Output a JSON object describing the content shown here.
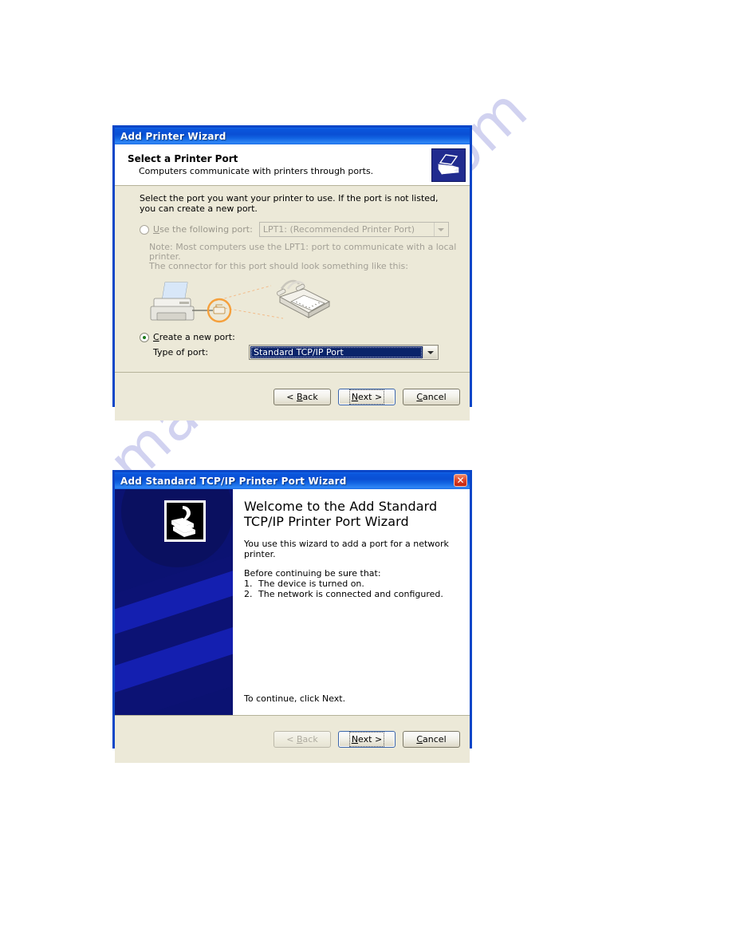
{
  "page": {
    "watermark_text": "manualshive.com"
  },
  "dialog1": {
    "title": "Add Printer Wizard",
    "heading": "Select a Printer Port",
    "subheading": "Computers communicate with printers through ports.",
    "header_icon": "printer-icon",
    "intro": "Select the port you want your printer to use.  If the port is not listed, you can create a new port.",
    "option_existing": {
      "label_prefix": "",
      "label_accel": "U",
      "label_rest": "se the following port:",
      "label_full": "Use the following port:",
      "selected": false,
      "enabled": false,
      "port_value": "LPT1: (Recommended Printer Port)"
    },
    "note_line1": "Note: Most computers use the LPT1: port to communicate with a local printer.",
    "note_line2": "The connector for this port should look something like this:",
    "illustration": {
      "printer_icon": "printer-illustration",
      "connector_icon": "parallel-port-connector-illustration",
      "highlight_icon": "orange-circle-highlight"
    },
    "option_new": {
      "label_accel": "C",
      "label_rest": "reate a new port:",
      "label_full": "Create a new port:",
      "selected": true,
      "enabled": true,
      "type_label": "Type of port:",
      "type_value": "Standard TCP/IP Port"
    },
    "buttons": {
      "back": "< Back",
      "back_accel": "B",
      "next": "Next >",
      "next_accel": "N",
      "cancel": "Cancel",
      "cancel_accel": "C",
      "back_enabled": true,
      "next_default": true
    }
  },
  "dialog2": {
    "title": "Add Standard TCP/IP Printer Port Wizard",
    "close_icon": "close-icon",
    "close_glyph": "✕",
    "sidebar_icon": "network-printer-icon",
    "welcome_title_line1": "Welcome to the Add Standard",
    "welcome_title_line2": "TCP/IP Printer Port Wizard",
    "paragraph": "You use this wizard to add a port for a network printer.",
    "before_label": "Before continuing be sure that:",
    "steps": [
      {
        "num": "1.",
        "text": "The device is turned on."
      },
      {
        "num": "2.",
        "text": "The network is connected and configured."
      }
    ],
    "continue_text": "To continue, click Next.",
    "buttons": {
      "back": "< Back",
      "back_accel": "B",
      "next": "Next >",
      "next_accel": "N",
      "cancel": "Cancel",
      "cancel_accel": "C",
      "back_enabled": false,
      "next_default": true
    }
  },
  "colors": {
    "titlebar_blue": "#0a4fd4",
    "dialog_border": "#0a46c8",
    "dialog_face": "#ece9d8",
    "sidebar_navy": "#0b1272",
    "selection_blue": "#0a246a",
    "close_red": "#c0240f",
    "watermark": "#c9cbee",
    "highlight_orange": "#f5a03c"
  }
}
